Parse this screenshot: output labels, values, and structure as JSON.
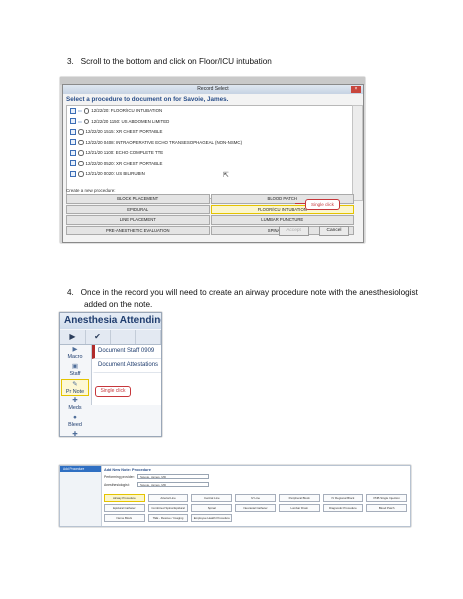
{
  "steps": [
    {
      "number": "3.",
      "text": "Scroll to the bottom and click on Floor/ICU intubation"
    },
    {
      "number": "4.",
      "line1": "Once in the record you will need to create an airway procedure note with the anesthesiologist",
      "line2": "added on the note."
    }
  ],
  "record_select": {
    "window_title": "Record Select",
    "close_glyph": "×",
    "heading": "Select a procedure to document on for Savoie, James.",
    "records": [
      "12/22/20: FLOOR/ICU INTUBATION",
      "12/22/20 1150: US ABDOMEN LIMITED",
      "12/22/20 1515: XR CHEST PORTABLE",
      "12/22/20 0408: INTRAOPERATIVE ECHO TRANSESOPHAGEAL (NON-NSMC)",
      "12/21/20 1100: ECHO COMPLETE TTE",
      "12/22/20 0520: XR CHEST PORTABLE",
      "12/21/20 0020: US BILIRUBIN"
    ],
    "create_label": "Create a new procedure:",
    "procedures": [
      "BLOCK PLACEMENT",
      "BLOOD PATCH",
      "EPIDURAL",
      "FLOOR/ICU INTUBATION",
      "LINE PLACEMENT",
      "LUMBAR PUNCTURE",
      "PRE-ANESTHETIC EVALUATION",
      "SPINAL DRAIN"
    ],
    "callout": "Single click",
    "accept_label": "Accept",
    "cancel_label": "Cancel"
  },
  "anesthesia_panel": {
    "title": "Anesthesia Attending",
    "toolbar": [
      "▶",
      "✔",
      "",
      ""
    ],
    "side_buttons": [
      {
        "icon": "▶",
        "label": "Macro"
      },
      {
        "icon": "▣",
        "label": "Staff"
      },
      {
        "icon": "✎",
        "label": "Pr Note"
      },
      {
        "icon": "✚",
        "label": "Meds"
      },
      {
        "icon": "●",
        "label": "Bleed"
      },
      {
        "icon": "✚",
        "label": ""
      }
    ],
    "documents": [
      "Document Staff 0909",
      "Document Attestations"
    ],
    "callout": "Single click"
  },
  "add_new_note": {
    "nav_selected": "Add Procedure",
    "title": "Add New Note: Procedure",
    "performing_label": "Performing provider:",
    "performing_value": "Savoie, James, MD",
    "attending_label": "Anesthesiologist:",
    "attending_value": "Savoie, James, MD",
    "procedures": [
      "Airway Procedure",
      "Arterial Line",
      "Central Line",
      "IV Line",
      "Peripheral Block",
      "IV Regional Block",
      "PNB Single Injection",
      "Epidural Catheter",
      "Combined Spinal Epidural",
      "Spinal",
      "Neuraxial Catheter",
      "Lumbar Drain",
      "Diagnostic Procedure",
      "Blood Patch",
      "Nerve Block",
      "TEE - Rescue / Imaging",
      "Employee Health Procedure"
    ]
  }
}
